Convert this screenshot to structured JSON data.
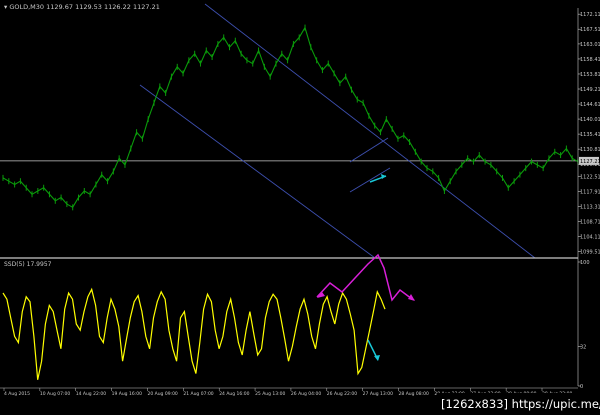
{
  "colors": {
    "background": "#000000",
    "price_line": "#0a9b0a",
    "oscillator_line": "#ffff00",
    "channel": "#3d4fae",
    "grid_divider": "#c8c8c8",
    "arrow_cyan": "#19c8d8",
    "arrow_magenta": "#d81fd8",
    "current_price_box": "#c8c8c8",
    "text": "#c8c8c8"
  },
  "header": {
    "symbol_label": "▾ GOLD,M30  1129.67  1129.53  1126.22  1127.21"
  },
  "sub_header": {
    "indicator_label": "SSD(5)  17.9957"
  },
  "watermark": "[1262x833] https://upic.me/",
  "chart_data": [
    {
      "type": "line",
      "panel": "price",
      "series": [
        {
          "values": [
            1122,
            1121,
            1120,
            1121,
            1119,
            1117,
            1118,
            1119,
            1117,
            1115,
            1116,
            1114,
            1113,
            1116,
            1118,
            1117,
            1120,
            1123,
            1121,
            1124,
            1128,
            1126,
            1131,
            1136,
            1134,
            1140,
            1145,
            1150,
            1148,
            1153,
            1156,
            1154,
            1158,
            1160,
            1157,
            1161,
            1159,
            1163,
            1165,
            1162,
            1164,
            1160,
            1158,
            1157,
            1161,
            1156,
            1153,
            1157,
            1160,
            1158,
            1163,
            1165,
            1168,
            1162,
            1158,
            1155,
            1157,
            1154,
            1151,
            1153,
            1149,
            1146,
            1145,
            1141,
            1138,
            1136,
            1140,
            1137,
            1134,
            1135,
            1133,
            1130,
            1127,
            1125,
            1124,
            1122,
            1118,
            1121,
            1124,
            1126,
            1128,
            1127,
            1129,
            1127,
            1126,
            1124,
            1122,
            1119,
            1121,
            1123,
            1125,
            1127,
            1126,
            1125,
            1128,
            1130,
            1129,
            1131,
            1128,
            1127
          ]
        }
      ],
      "y_ticks": [
        "1172.11",
        "1167.51",
        "1163.01",
        "1158.41",
        "1153.81",
        "1149.21",
        "1144.61",
        "1140.01",
        "1135.41",
        "1130.81",
        "1126.21",
        "1122.51",
        "1117.91",
        "1113.31",
        "1108.71",
        "1104.11",
        "1099.51"
      ],
      "current_price": "1127.21",
      "ylim": [
        1097.5,
        1174.0
      ]
    },
    {
      "type": "line",
      "panel": "oscillator",
      "series": [
        {
          "values": [
            75,
            70,
            55,
            40,
            35,
            60,
            72,
            68,
            40,
            5,
            20,
            50,
            65,
            60,
            45,
            30,
            62,
            75,
            70,
            50,
            45,
            60,
            72,
            78,
            65,
            40,
            35,
            55,
            70,
            62,
            48,
            20,
            38,
            55,
            68,
            73,
            60,
            40,
            30,
            55,
            68,
            76,
            70,
            45,
            30,
            20,
            55,
            60,
            40,
            20,
            10,
            35,
            62,
            74,
            68,
            45,
            30,
            40,
            60,
            70,
            55,
            35,
            25,
            45,
            60,
            42,
            25,
            30,
            55,
            68,
            74,
            70,
            55,
            38,
            20,
            32,
            48,
            62,
            70,
            58,
            40,
            30,
            50,
            66,
            72,
            60,
            50,
            66,
            75,
            70,
            58,
            45,
            10,
            15,
            30,
            45,
            60,
            76,
            70,
            62
          ]
        }
      ],
      "y_ticks": [
        "100",
        "32",
        "0"
      ],
      "ylim": [
        0,
        100
      ]
    }
  ],
  "x_ticks": [
    "4 Aug 2015",
    "10 Aug 07:00",
    "14 Aug 22:00",
    "19 Aug 16:00",
    "20 Aug 09:00",
    "21 Aug 07:00",
    "24 Aug 16:00",
    "25 Aug 13:00",
    "26 Aug 04:00",
    "26 Aug 22:00",
    "27 Aug 13:00",
    "28 Aug 08:00",
    "28 Aug 23:00",
    "27 Aug 22:00",
    "28 Aug 00:00",
    "28 Aug 22:00"
  ]
}
